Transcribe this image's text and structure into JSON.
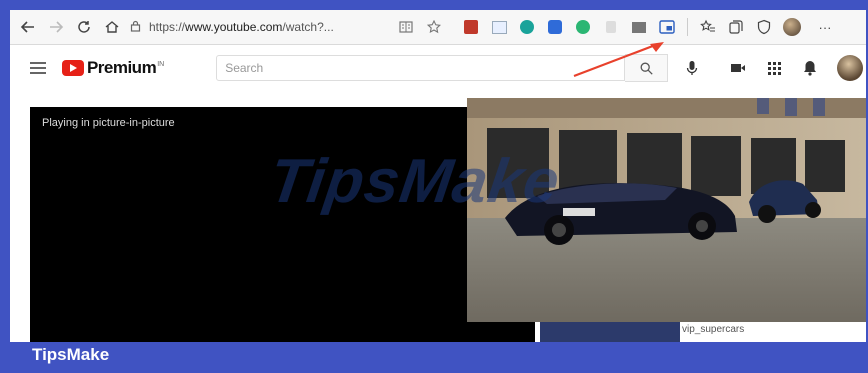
{
  "browser": {
    "url_scheme": "https://",
    "url_host": "www.youtube.com",
    "url_path": "/watch?...",
    "more_label": "···"
  },
  "youtube": {
    "logo_text": "Premium",
    "logo_sup": "IN",
    "search_placeholder": "Search"
  },
  "player": {
    "pip_text": "Playing in picture-in-picture"
  },
  "sidebar": {
    "caption": "vip_supercars"
  },
  "watermark": "TipsMake",
  "footer_brand": "TipsMake",
  "colors": {
    "frame_bg": "#4053c2",
    "arrow": "#e8412c",
    "yt_red": "#e62117"
  }
}
